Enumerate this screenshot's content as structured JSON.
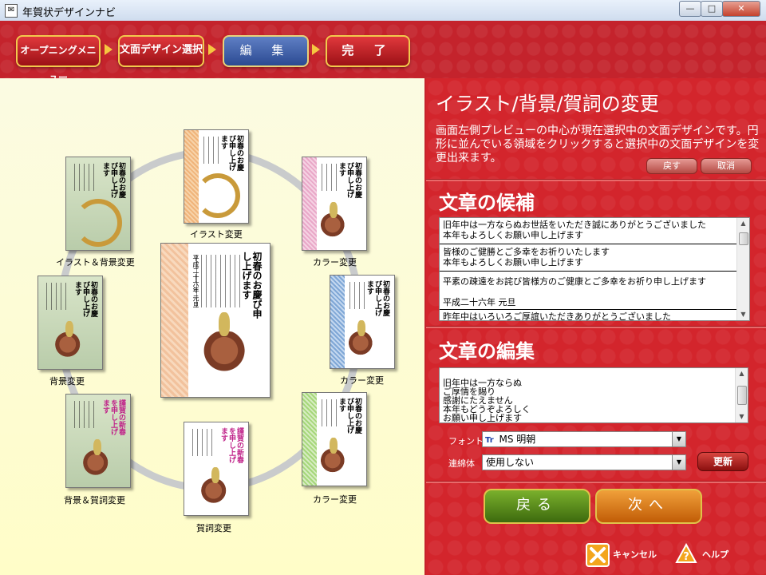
{
  "window": {
    "title": "年賀状デザインナビ",
    "controls": {
      "minimize": "—",
      "maximize": "□",
      "close": "✕"
    }
  },
  "steps": [
    {
      "label": "オープニングメニュー",
      "state": "done"
    },
    {
      "label": "文面デザイン選択",
      "state": "done"
    },
    {
      "label": "編 集",
      "state": "current"
    },
    {
      "label": "完 了",
      "state": "pending"
    }
  ],
  "preview": {
    "center_card": {
      "greeting": "初春のお慶び申し上げます",
      "date": "平成二十六年 元旦"
    },
    "options": [
      {
        "label": "イラスト変更",
        "greeting": "初春のお慶び申し上げます"
      },
      {
        "label": "カラー変更",
        "greeting": "初春のお慶び申し上げます"
      },
      {
        "label": "カラー変更",
        "greeting": "初春のお慶び申し上げます"
      },
      {
        "label": "カラー変更",
        "greeting": "初春のお慶び申し上げます"
      },
      {
        "label": "賀詞変更",
        "greeting": "謹賀の新春を申し上げます"
      },
      {
        "label": "背景＆賀詞変更",
        "greeting": "謹賀の新春を申し上げます"
      },
      {
        "label": "背景変更",
        "greeting": "初春のお慶び申し上げます"
      },
      {
        "label": "イラスト＆背景変更",
        "greeting": "初春のお慶び申し上げます"
      }
    ]
  },
  "panel": {
    "change_title": "イラスト/背景/賀詞の変更",
    "description": "画面左側プレビューの中心が現在選択中の文面デザインです。円形に並んでいる領域をクリックすると選択中の文面デザインを変更出来ます。",
    "revert_label": "戻す",
    "cancel_label": "取消",
    "candidates_title": "文章の候補",
    "candidates": [
      "旧年中は一方ならぬお世話をいただき誠にありがとうございました\n本年もよろしくお願い申し上げます",
      "皆様のご健勝とご多幸をお祈りいたします\n本年もよろしくお願い申し上げます",
      "平素の疎遠をお詫び皆様方のご健康とご多幸をお祈り申し上げます\n\n平成二十六年 元旦",
      "昨年中はいろいろご厚誼いただきありがとうございました"
    ],
    "edit_title": "文章の編集",
    "edit_text": "旧年中は一方ならぬ\nご厚情を賜り\n感謝にたえません\n本年もどうぞよろしく\nお願い申し上げます",
    "font_label": "フォント",
    "font_value": "MS 明朝",
    "font_icon": "Tr",
    "ligature_label": "連綿体",
    "ligature_value": "使用しない",
    "update_label": "更新",
    "back_label": "戻る",
    "next_label": "次へ",
    "cancel_button_label": "キャンセル",
    "help_button_label": "ヘルプ"
  },
  "colors": {
    "header_red": "#c4232c",
    "panel_red": "#d3252c",
    "current_step_blue": "#2b4a92",
    "back_green": "#5e8f1e",
    "next_orange": "#e07a1a",
    "preview_bg": "#fdfcd4"
  }
}
